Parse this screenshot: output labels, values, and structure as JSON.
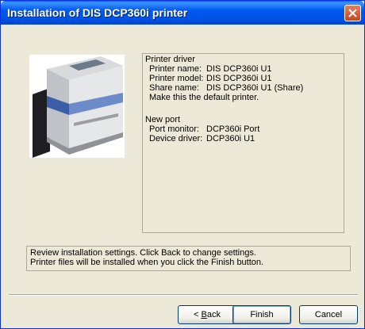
{
  "window": {
    "title": "Installation of DIS DCP360i printer"
  },
  "printer_driver": {
    "heading": "Printer driver",
    "printer_name_label": "Printer name:",
    "printer_name_value": "DIS DCP360i U1",
    "printer_model_label": "Printer model:",
    "printer_model_value": "DIS DCP360i U1",
    "share_name_label": "Share name:",
    "share_name_value": "DIS DCP360i U1 (Share)",
    "default_note": "Make this the default printer."
  },
  "new_port": {
    "heading": "New port",
    "port_monitor_label": "Port monitor:",
    "port_monitor_value": "DCP360i Port",
    "device_driver_label": "Device driver:",
    "device_driver_value": "DCP360i U1"
  },
  "status": {
    "line1": "Review installation settings. Click Back to change settings.",
    "line2": "Printer files will be installed when you click the Finish button."
  },
  "buttons": {
    "back_mnemonic": "B",
    "back_rest": "ack",
    "back_prefix": "< ",
    "finish": "Finish",
    "cancel": "Cancel"
  },
  "icons": {
    "close": "close-icon",
    "printer": "printer-image"
  }
}
